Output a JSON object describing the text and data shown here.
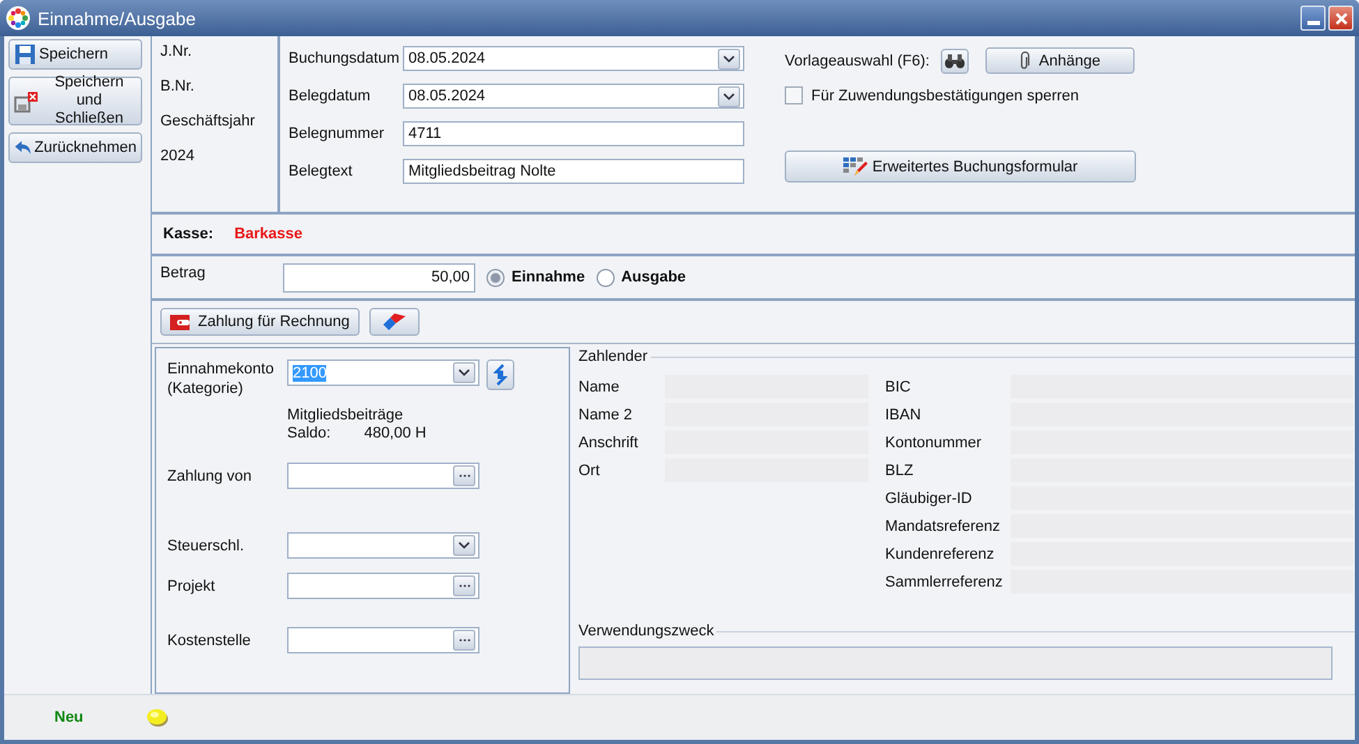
{
  "window": {
    "title": "Einnahme/Ausgabe"
  },
  "toolbar": [
    {
      "label": "Speichern",
      "kind": "save"
    },
    {
      "label": "Speichern und Schließen",
      "kind": "save-close"
    },
    {
      "label": "Zurücknehmen",
      "kind": "undo"
    }
  ],
  "info": [
    "J.Nr.",
    "B.Nr.",
    "Geschäftsjahr",
    "2024"
  ],
  "booking_fields": [
    {
      "label": "Buchungsdatum",
      "value": "08.05.2024",
      "kind": "dropdown"
    },
    {
      "label": "Belegdatum",
      "value": "08.05.2024",
      "kind": "dropdown"
    },
    {
      "label": "Belegnummer",
      "value": "4711",
      "kind": "text"
    },
    {
      "label": "Belegtext",
      "value": "Mitgliedsbeitrag Nolte",
      "kind": "text"
    }
  ],
  "template": {
    "label": "Vorlageauswahl (F6):",
    "attachments_button": "Anhänge"
  },
  "lock_checkbox": {
    "label": "Für Zuwendungsbestätigungen sperren",
    "checked": false
  },
  "extended_button": "Erweitertes Buchungsformular",
  "cash": {
    "label": "Kasse:",
    "value": "Barkasse"
  },
  "amount": {
    "label": "Betrag",
    "value": "50,00"
  },
  "type_options": [
    {
      "label": "Einnahme",
      "selected": true
    },
    {
      "label": "Ausgabe",
      "selected": false
    }
  ],
  "invoice_button": "Zahlung für Rechnung",
  "category": {
    "label": "Einnahmekonto\n(Kategorie)",
    "value": "2100",
    "account_name": "Mitgliedsbeiträge",
    "balance_label": "Saldo:",
    "balance": "480,00 H"
  },
  "left_fields": [
    {
      "label": "Zahlung von",
      "kind": "lookup"
    },
    {
      "label": "Steuerschl.",
      "kind": "dropdown"
    },
    {
      "label": "Projekt",
      "kind": "lookup"
    },
    {
      "label": "Kostenstelle",
      "kind": "lookup"
    }
  ],
  "payer": {
    "title": "Zahlender",
    "left": [
      "Name",
      "Name 2",
      "Anschrift",
      "Ort"
    ],
    "right": [
      "BIC",
      "IBAN",
      "Kontonummer",
      "BLZ",
      "Gläubiger-ID",
      "Mandatsreferenz",
      "Kundenreferenz",
      "Sammlerreferenz"
    ]
  },
  "purpose": {
    "title": "Verwendungszweck"
  },
  "status": {
    "label": "Neu"
  }
}
